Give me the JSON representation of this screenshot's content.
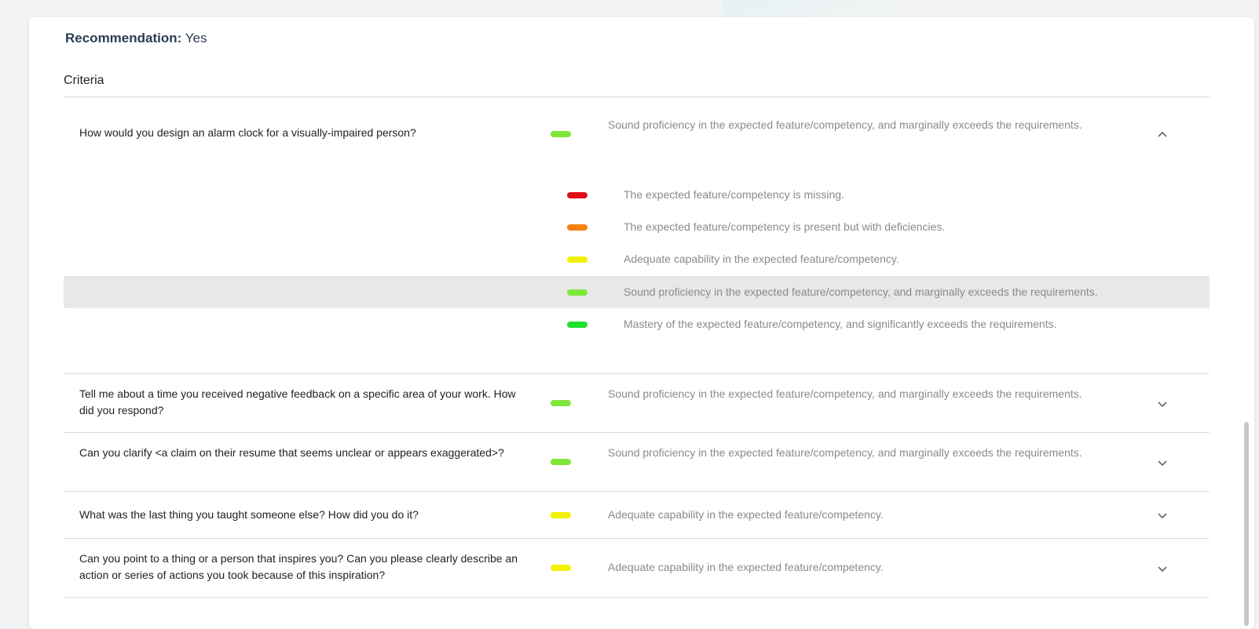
{
  "recommendation": {
    "label": "Recommendation:",
    "value": " Yes"
  },
  "criteria": {
    "title": "Criteria",
    "rows": [
      {
        "question": "How would you design an alarm clock for a visually-impaired person?",
        "rating_text": "Sound proficiency in the expected feature/competency, and marginally exceeds the requirements.",
        "rating_color": "#7ee83a",
        "expanded": true,
        "chevron": "chevron-up-icon"
      },
      {
        "question": "Tell me about a time you received negative feedback on a specific area of your work. How did you respond?",
        "rating_text": "Sound proficiency in the expected feature/competency, and marginally exceeds the requirements.",
        "rating_color": "#7ee83a",
        "expanded": false,
        "chevron": "chevron-down-icon"
      },
      {
        "question": "Can you clarify <a claim on their resume that seems unclear or appears exaggerated>?",
        "rating_text": "Sound proficiency in the expected feature/competency, and marginally exceeds the requirements.",
        "rating_color": "#7ee83a",
        "expanded": false,
        "chevron": "chevron-down-icon"
      },
      {
        "question": "What was the last thing you taught someone else? How did you do it?",
        "rating_text": "Adequate capability in the expected feature/competency.",
        "rating_color": "#f2f200",
        "expanded": false,
        "chevron": "chevron-down-icon"
      },
      {
        "question": "Can you point to a thing or a person that inspires you? Can you please clearly describe an action or series of actions you took because of this inspiration?",
        "rating_text": "Adequate capability in the expected feature/competency.",
        "rating_color": "#f2f200",
        "expanded": false,
        "chevron": "chevron-down-icon"
      }
    ],
    "options": [
      {
        "label": "The expected feature/competency is missing.",
        "color": "#e0101a",
        "selected": false
      },
      {
        "label": "The expected feature/competency is present but with deficiencies.",
        "color": "#f5820f",
        "selected": false
      },
      {
        "label": "Adequate capability in the expected feature/competency.",
        "color": "#f2f200",
        "selected": false
      },
      {
        "label": "Sound proficiency in the expected feature/competency, and marginally exceeds the requirements.",
        "color": "#7ee83a",
        "selected": true
      },
      {
        "label": "Mastery of the expected feature/competency, and significantly exceeds the requirements.",
        "color": "#1ee02e",
        "selected": false
      }
    ]
  }
}
